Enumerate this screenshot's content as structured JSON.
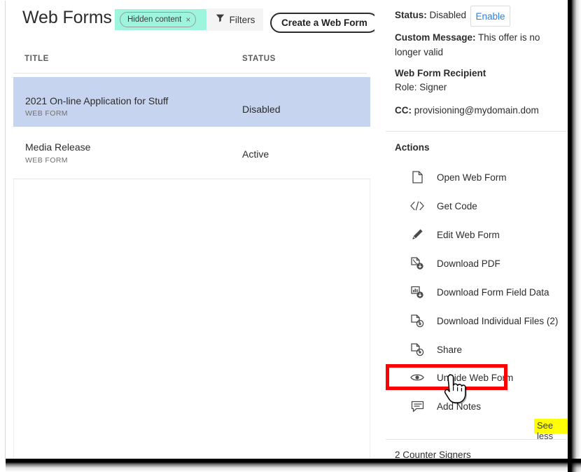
{
  "toolbar": {
    "page_title": "Web Forms",
    "chip_label": "Hidden content",
    "chip_close_glyph": "×",
    "filters_label": "Filters",
    "create_label": "Create a Web Form"
  },
  "table": {
    "columns": [
      "TITLE",
      "STATUS"
    ],
    "rows": [
      {
        "title": "2021 On-line Application for Stuff",
        "subtitle": "WEB FORM",
        "status": "Disabled",
        "selected": true
      },
      {
        "title": "Media Release",
        "subtitle": "WEB FORM",
        "status": "Active",
        "selected": false
      }
    ]
  },
  "details": {
    "status_key": "Status:",
    "status_value": "Disabled",
    "enable_label": "Enable",
    "custom_message_key": "Custom Message:",
    "custom_message_value": "This offer is no longer valid",
    "recipient_heading": "Web Form Recipient",
    "recipient_role": "Role: Signer",
    "cc_key": "CC:",
    "cc_value": "provisioning@mydomain.dom"
  },
  "actions": {
    "heading": "Actions",
    "items": [
      {
        "label": "Open Web Form",
        "icon": "document-icon",
        "highlighted": false
      },
      {
        "label": "Get Code",
        "icon": "code-icon",
        "highlighted": false
      },
      {
        "label": "Edit Web Form",
        "icon": "pencil-icon",
        "highlighted": false
      },
      {
        "label": "Download PDF",
        "icon": "download-pdf-icon",
        "highlighted": false
      },
      {
        "label": "Download Form Field Data",
        "icon": "download-data-icon",
        "highlighted": false
      },
      {
        "label": "Download Individual Files (2)",
        "icon": "download-files-icon",
        "highlighted": false
      },
      {
        "label": "Share",
        "icon": "share-icon",
        "highlighted": false
      },
      {
        "label": "Unhide Web Form",
        "icon": "eye-icon",
        "highlighted": true
      },
      {
        "label": "Add Notes",
        "icon": "note-icon",
        "highlighted": false
      }
    ],
    "see_less_label": "See less",
    "counter_signers_label": "2 Counter Signers"
  },
  "colors": {
    "chip_highlight": "#9ef5dd",
    "selected_row": "#c6d4ef",
    "link_blue": "#2680eb",
    "annotation_red": "#ff0000",
    "annotation_yellow": "#ffff00"
  }
}
